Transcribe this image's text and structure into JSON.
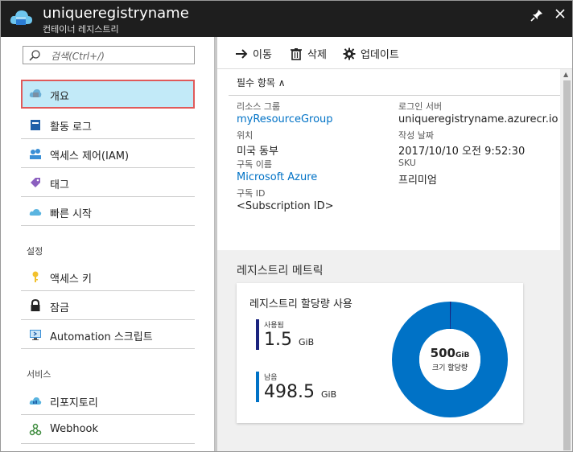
{
  "window": {
    "title": "uniqueregistryname",
    "subtitle": "컨테이너 레지스트리",
    "pin_glyph": "✎",
    "close_glyph": "✕"
  },
  "sidebar": {
    "search_placeholder": "검색(Ctrl+/)",
    "items_top": [
      {
        "label": "개요",
        "icon": "cloud-registry-icon",
        "active": true
      },
      {
        "label": "활동 로그",
        "icon": "activity-log-icon"
      },
      {
        "label": "액세스 제어(IAM)",
        "icon": "access-control-icon"
      },
      {
        "label": "태그",
        "icon": "tag-icon"
      },
      {
        "label": "빠른 시작",
        "icon": "quickstart-icon"
      }
    ],
    "section_settings": "설정",
    "items_settings": [
      {
        "label": "액세스 키",
        "icon": "key-icon"
      },
      {
        "label": "잠금",
        "icon": "lock-icon"
      },
      {
        "label": "Automation 스크립트",
        "icon": "automation-script-icon"
      }
    ],
    "section_services": "서비스",
    "items_services": [
      {
        "label": "리포지토리",
        "icon": "repository-icon"
      },
      {
        "label": "Webhook",
        "icon": "webhook-icon"
      }
    ]
  },
  "toolbar": {
    "move_label": "이동",
    "delete_label": "삭제",
    "update_label": "업데이트"
  },
  "essentials": {
    "toggle_label": "필수 항목 ∧",
    "resource_group_label": "리소스 그룹",
    "resource_group_value": "myResourceGroup",
    "location_label": "위치",
    "location_value": "미국 동부",
    "subscription_name_label": "구독 이름",
    "subscription_name_value": "Microsoft Azure",
    "subscription_id_label": "구독 ID",
    "subscription_id_value": "<Subscription ID>",
    "login_server_label": "로그인 서버",
    "login_server_value": "uniqueregistryname.azurecr.io",
    "created_label": "작성 날짜",
    "created_value": "2017/10/10 오전 9:52:30",
    "sku_label": "SKU",
    "sku_value": "프리미엄"
  },
  "metrics": {
    "section_title": "레지스트리 메트릭",
    "card_title": "레지스트리 할당량 사용",
    "used_label": "사용됨",
    "used_value": "1.5",
    "used_unit": "GiB",
    "free_label": "남음",
    "free_value": "498.5",
    "free_unit": "GiB",
    "total_value": "500",
    "total_unit": "GiB",
    "total_label": "크기 할당량",
    "used_fraction": 0.003,
    "colors": {
      "used": "#1a237e",
      "free": "#0072c6"
    }
  }
}
